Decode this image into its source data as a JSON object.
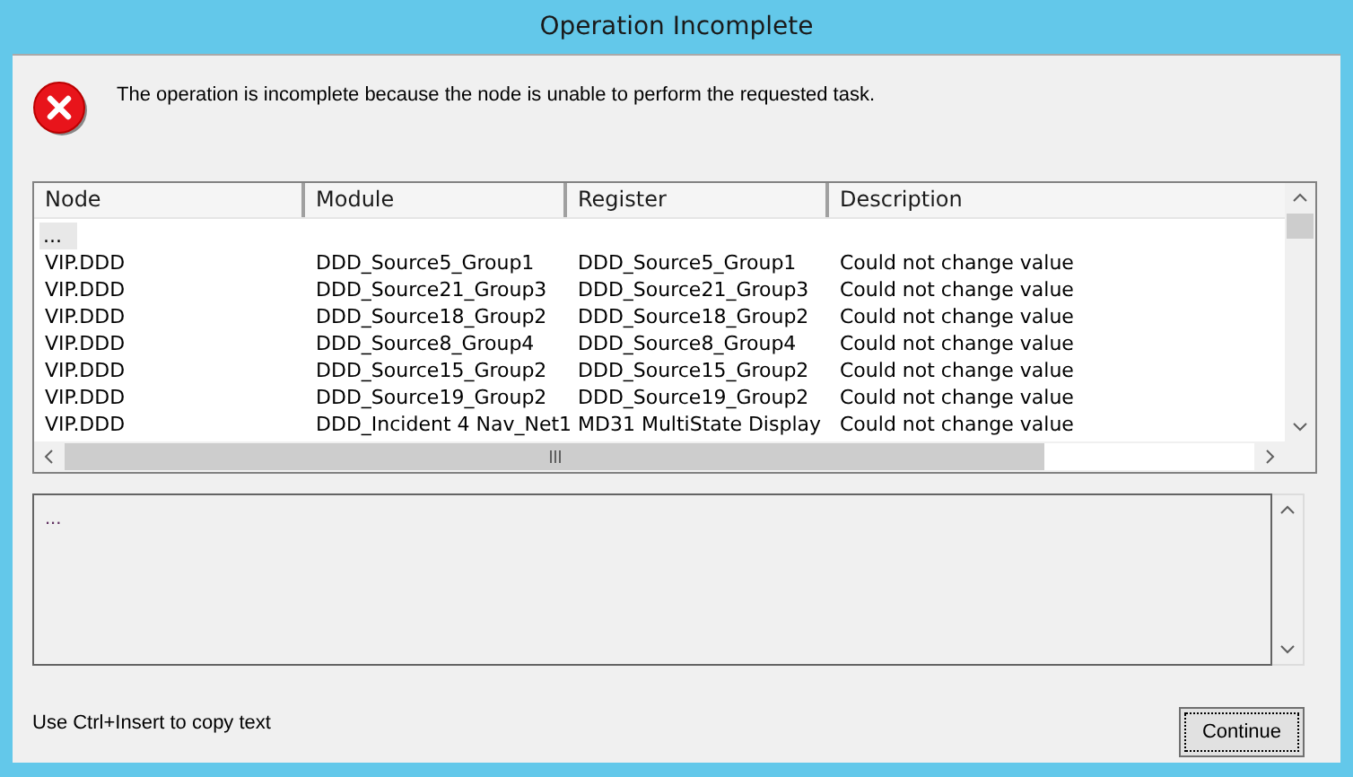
{
  "window": {
    "title": "Operation Incomplete"
  },
  "message": "The operation is incomplete because the node is unable to perform the requested task.",
  "table": {
    "columns": [
      "Node",
      "Module",
      "Register",
      "Description"
    ],
    "rows": [
      {
        "cells": [
          "...",
          "",
          "",
          ""
        ],
        "selected": true
      },
      {
        "cells": [
          "VIP.DDD",
          "DDD_Source5_Group1",
          "DDD_Source5_Group1",
          "Could not change value"
        ],
        "selected": false
      },
      {
        "cells": [
          "VIP.DDD",
          "DDD_Source21_Group3",
          "DDD_Source21_Group3",
          "Could not change value"
        ],
        "selected": false
      },
      {
        "cells": [
          "VIP.DDD",
          "DDD_Source18_Group2",
          "DDD_Source18_Group2",
          "Could not change value"
        ],
        "selected": false
      },
      {
        "cells": [
          "VIP.DDD",
          "DDD_Source8_Group4",
          "DDD_Source8_Group4",
          "Could not change value"
        ],
        "selected": false
      },
      {
        "cells": [
          "VIP.DDD",
          "DDD_Source15_Group2",
          "DDD_Source15_Group2",
          "Could not change value"
        ],
        "selected": false
      },
      {
        "cells": [
          "VIP.DDD",
          "DDD_Source19_Group2",
          "DDD_Source19_Group2",
          "Could not change value"
        ],
        "selected": false
      },
      {
        "cells": [
          "VIP.DDD",
          "DDD_Incident 4 Nav_Net1",
          "MD31 MultiState Display",
          "Could not change value"
        ],
        "selected": false
      }
    ]
  },
  "details": {
    "text": "..."
  },
  "hint": "Use Ctrl+Insert to copy text",
  "button": {
    "label": "Continue"
  }
}
